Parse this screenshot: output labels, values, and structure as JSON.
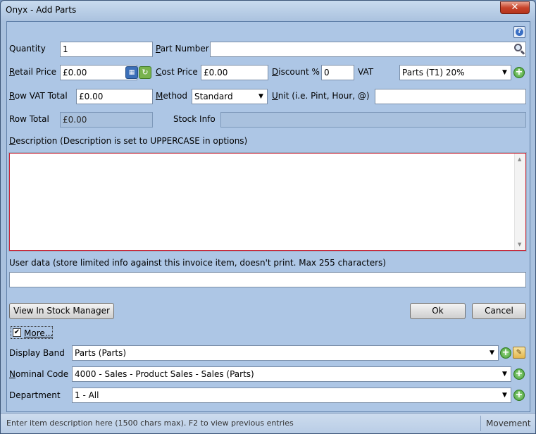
{
  "window": {
    "title": "Onyx - Add Parts",
    "close_label": "✕"
  },
  "help_icon": "?",
  "fields": {
    "quantity": {
      "label": "Quantity",
      "value": "1"
    },
    "part_number": {
      "label": "Part Number",
      "value": ""
    },
    "retail_price": {
      "label": "Retail Price",
      "value": "£0.00"
    },
    "cost_price": {
      "label": "Cost Price",
      "value": "£0.00"
    },
    "discount": {
      "label": "Discount %",
      "value": "0"
    },
    "vat": {
      "label": "VAT",
      "value": "Parts (T1) 20%"
    },
    "row_vat_total": {
      "label": "Row VAT Total",
      "value": "£0.00"
    },
    "method": {
      "label": "Method",
      "value": "Standard"
    },
    "unit": {
      "label": "Unit (i.e. Pint, Hour, @)",
      "value": ""
    },
    "row_total": {
      "label": "Row Total",
      "value": "£0.00"
    },
    "stock_info": {
      "label": "Stock Info",
      "value": ""
    }
  },
  "description": {
    "label": "Description (Description is set to UPPERCASE in options)",
    "value": ""
  },
  "user_data": {
    "label": "User data (store limited info against this invoice item, doesn't print.  Max 255 characters)",
    "value": ""
  },
  "buttons": {
    "view_stock": "View In Stock Manager",
    "ok": "Ok",
    "cancel": "Cancel"
  },
  "more": {
    "label": "More...",
    "checked": true
  },
  "extra": {
    "display_band": {
      "label": "Display Band",
      "value": "Parts (Parts)"
    },
    "nominal_code": {
      "label": "Nominal Code",
      "value": "4000 - Sales - Product Sales - Sales (Parts)"
    },
    "department": {
      "label": "Department",
      "value": "1 - All"
    }
  },
  "status": {
    "hint": "Enter item description here (1500 chars max).  F2 to view previous entries",
    "mode": "Movement"
  }
}
